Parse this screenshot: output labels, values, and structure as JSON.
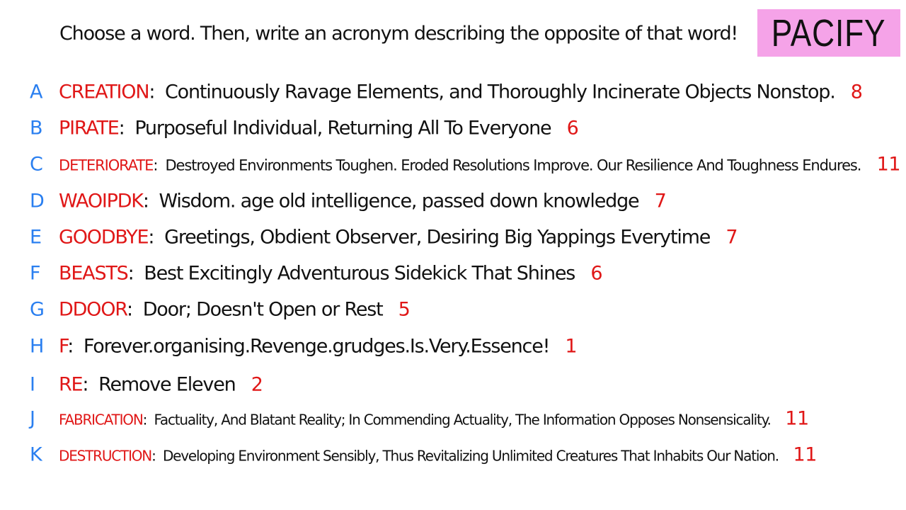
{
  "header": {
    "prompt": "Choose a word. Then, write an acronym describing the opposite of that word!",
    "badge": "PACIFY"
  },
  "entries": [
    {
      "letter": "A",
      "word": "CREATION",
      "acronym": "Continuously Ravage Elements, and Thoroughly Incinerate Objects Nonstop.",
      "count": "8"
    },
    {
      "letter": "B",
      "word": "PIRATE",
      "acronym": "Purposeful Individual, Returning All To Everyone",
      "count": "6"
    },
    {
      "letter": "C",
      "word": "DETERIORATE",
      "acronym": "Destroyed Environments Toughen. Eroded Resolutions Improve. Our Resilience And Toughness Endures.",
      "count": "11"
    },
    {
      "letter": "D",
      "word": "WAOIPDK",
      "acronym": "Wisdom. age old intelligence, passed down knowledge",
      "count": "7"
    },
    {
      "letter": "E",
      "word": "GOODBYE",
      "acronym": "Greetings, Obdient Observer, Desiring Big Yappings Everytime",
      "count": "7"
    },
    {
      "letter": "F",
      "word": "BEASTS",
      "acronym": "Best Excitingly Adventurous Sidekick That Shines",
      "count": "6"
    },
    {
      "letter": "G",
      "word": "DDOOR",
      "acronym": "Door; Doesn't Open or Rest",
      "count": "5"
    },
    {
      "letter": "H",
      "word": "F",
      "acronym": "Forever.organising.Revenge.grudges.Is.Very.Essence!",
      "count": "1"
    },
    {
      "letter": "I",
      "word": "RE",
      "acronym": "Remove Eleven",
      "count": "2"
    },
    {
      "letter": "J",
      "word": "FABRICATION",
      "acronym": "Factuality, And Blatant Reality; In Commending Actuality, The Information Opposes Nonsensicality.",
      "count": "11"
    },
    {
      "letter": "K",
      "word": "DESTRUCTION",
      "acronym": "Developing Environment Sensibly, Thus Revitalizing Unlimited Creatures That Inhabits Our Nation.",
      "count": "11"
    }
  ],
  "colors": {
    "letter": "#2a7ff0",
    "word": "#e01717",
    "count": "#e01717",
    "text": "#111111",
    "badge_background": "#f5a3e8"
  }
}
